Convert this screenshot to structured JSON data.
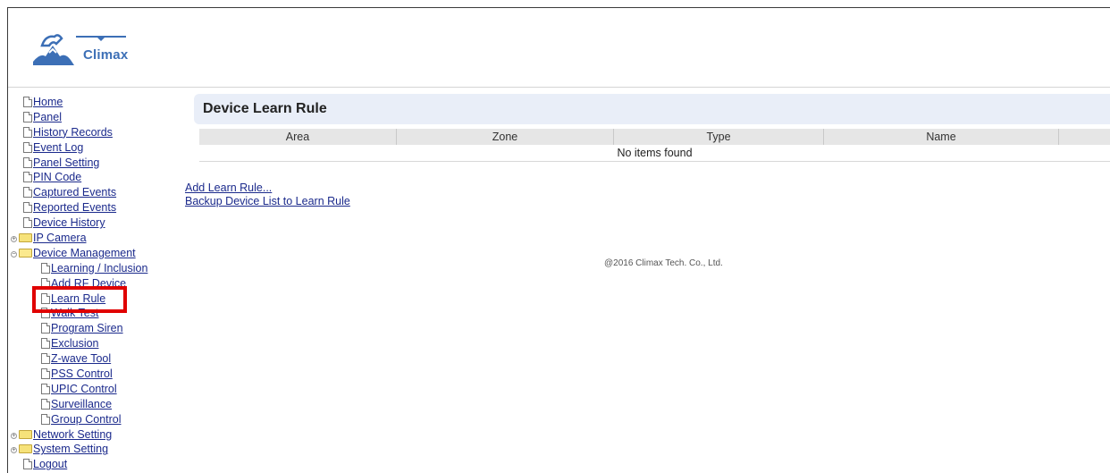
{
  "brand": {
    "name": "Climax"
  },
  "sidebar": {
    "items": [
      {
        "label": "Home",
        "type": "doc",
        "level": 0
      },
      {
        "label": "Panel",
        "type": "doc",
        "level": 0
      },
      {
        "label": "History Records",
        "type": "doc",
        "level": 0
      },
      {
        "label": "Event Log",
        "type": "doc",
        "level": 0
      },
      {
        "label": "Panel Setting",
        "type": "doc",
        "level": 0
      },
      {
        "label": "PIN Code",
        "type": "doc",
        "level": 0
      },
      {
        "label": "Captured Events",
        "type": "doc",
        "level": 0
      },
      {
        "label": "Reported Events",
        "type": "doc",
        "level": 0
      },
      {
        "label": "Device History",
        "type": "doc",
        "level": 0
      },
      {
        "label": "IP Camera",
        "type": "folder",
        "level": 0,
        "expander": "+"
      },
      {
        "label": "Device Management",
        "type": "folder",
        "level": 0,
        "expander": "−"
      },
      {
        "label": "Learning / Inclusion",
        "type": "doc",
        "level": 1
      },
      {
        "label": "Add RF Device",
        "type": "doc",
        "level": 1
      },
      {
        "label": "Learn Rule",
        "type": "doc",
        "level": 1,
        "selected": true
      },
      {
        "label": "Walk Test",
        "type": "doc",
        "level": 1
      },
      {
        "label": "Program Siren",
        "type": "doc",
        "level": 1
      },
      {
        "label": "Exclusion",
        "type": "doc",
        "level": 1
      },
      {
        "label": "Z-wave Tool",
        "type": "doc",
        "level": 1
      },
      {
        "label": "PSS Control",
        "type": "doc",
        "level": 1
      },
      {
        "label": "UPIC Control",
        "type": "doc",
        "level": 1
      },
      {
        "label": "Surveillance",
        "type": "doc",
        "level": 1
      },
      {
        "label": "Group Control",
        "type": "doc",
        "level": 1
      },
      {
        "label": "Network Setting",
        "type": "folder",
        "level": 0,
        "expander": "+"
      },
      {
        "label": "System Setting",
        "type": "folder",
        "level": 0,
        "expander": "+"
      },
      {
        "label": "Logout",
        "type": "doc",
        "level": 0
      }
    ]
  },
  "main": {
    "title": "Device Learn Rule",
    "table": {
      "columns": [
        "Area",
        "Zone",
        "Type",
        "Name",
        ""
      ],
      "empty_text": "No items found"
    },
    "links": [
      "Add Learn Rule...",
      "Backup Device List to Learn Rule"
    ],
    "copyright": "@2016 Climax Tech. Co., Ltd."
  },
  "colors": {
    "highlight": "#e00000",
    "link": "#1b2a8c",
    "title_bg": "#e9eef8"
  }
}
